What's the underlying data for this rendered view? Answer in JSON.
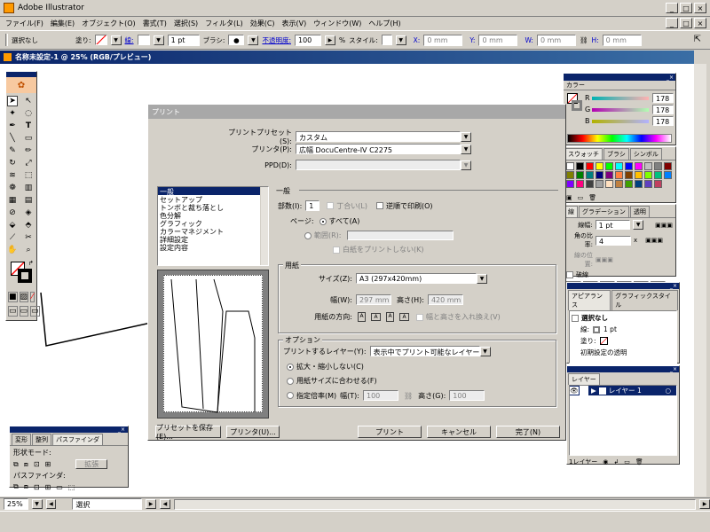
{
  "app": {
    "title": "Adobe Illustrator"
  },
  "menu": [
    "ファイル(F)",
    "編集(E)",
    "オブジェクト(O)",
    "書式(T)",
    "選択(S)",
    "フィルタ(L)",
    "効果(C)",
    "表示(V)",
    "ウィンドウ(W)",
    "ヘルプ(H)"
  ],
  "control": {
    "selection": "選択なし",
    "fill": "塗り:",
    "stroke": "線:",
    "stroke_weight": "1 pt",
    "brush": "ブラシ:",
    "opacity_label": "不透明度:",
    "opacity": "100",
    "percent": "%",
    "style": "スタイル:",
    "x": "X:",
    "y": "Y:",
    "w": "W:",
    "h": "H:",
    "unit": "0 mm"
  },
  "document": {
    "title": "名称未設定-1 @ 25% (RGB/プレビュー)"
  },
  "status": {
    "zoom": "25%",
    "mode": "選択"
  },
  "dialog": {
    "title": "プリント",
    "preset_label": "プリントプリセット(S):",
    "preset": "カスタム",
    "printer_label": "プリンタ(P):",
    "printer": "広幅 DocuCentre-IV C2275",
    "ppd_label": "PPD(D):",
    "categories": [
      "一般",
      "セットアップ",
      "トンボと裁ち落とし",
      "色分解",
      "グラフィック",
      "カラーマネジメント",
      "詳細設定",
      "設定内容"
    ],
    "section_general": "一般",
    "copies_label": "部数(I):",
    "copies": "1",
    "collate": "丁合い(L)",
    "reverse": "逆順で印刷(O)",
    "pages_label": "ページ:",
    "all": "すべて(A)",
    "range": "範囲(R):",
    "skip_blank": "白紙をプリントしない(K)",
    "section_paper": "用紙",
    "size_label": "サイズ(Z):",
    "size": "A3 (297x420mm)",
    "width_label": "幅(W):",
    "width": "297 mm",
    "height_label": "高さ(H):",
    "height": "420 mm",
    "orientation_label": "用紙の方向:",
    "transverse": "幅と高さを入れ換え(V)",
    "section_options": "オプション",
    "layers_label": "プリントするレイヤー(Y):",
    "layers": "表示中でプリント可能なレイヤー",
    "no_scale": "拡大・縮小しない(C)",
    "fit": "用紙サイズに合わせる(F)",
    "custom_scale": "指定倍率(M)",
    "scale_w_label": "幅(T):",
    "scale_w": "100",
    "scale_h_label": "高さ(G):",
    "scale_h": "100",
    "save_preset": "プリセットを保存(E)...",
    "printer_btn": "プリンタ(U)...",
    "print": "プリント",
    "cancel": "キャンセル",
    "done": "完了(N)"
  },
  "color_panel": {
    "title": "カラー",
    "rows": [
      {
        "label": "R",
        "value": "178"
      },
      {
        "label": "G",
        "value": "178"
      },
      {
        "label": "B",
        "value": "178"
      }
    ]
  },
  "swatch_panel": {
    "tabs": [
      "スウォッチ",
      "ブラシ",
      "シンボル"
    ]
  },
  "stroke_panel": {
    "tabs": [
      "線",
      "グラデーション",
      "透明"
    ],
    "weight_label": "線幅:",
    "weight": "1 pt",
    "miter_label": "角の比率:",
    "miter": "4",
    "x": "x",
    "align_label": "線の位置:",
    "dashed": "破線",
    "dash_labels": [
      "線分",
      "間隔",
      "線分",
      "間隔",
      "線分",
      "間隔"
    ]
  },
  "appearance_panel": {
    "tabs": [
      "アピアランス",
      "グラフィックスタイル"
    ],
    "selection": "選択なし",
    "stroke_label": "線:",
    "stroke_value": "1 pt",
    "fill_label": "塗り:",
    "opacity": "初期設定の透明"
  },
  "layers_panel": {
    "tab": "レイヤー",
    "layer": "レイヤー 1",
    "count": "1レイヤー"
  },
  "pathfinder": {
    "tabs": [
      "変形",
      "整列",
      "パスファインダ"
    ],
    "shape_modes": "形状モード:",
    "expand": "拡張",
    "pathfinders": "パスファインダ:"
  },
  "colors": {
    "accent": "#0a246a",
    "swatches": [
      "#ffffff",
      "#000000",
      "#ff0000",
      "#ffff00",
      "#00ff00",
      "#00ffff",
      "#0000ff",
      "#ff00ff",
      "#c0c0c0",
      "#808080",
      "#800000",
      "#808000",
      "#008000",
      "#008080",
      "#000080",
      "#800080",
      "#ff8040",
      "#804000",
      "#ffc000",
      "#80ff00",
      "#00c080",
      "#0080ff",
      "#8000ff",
      "#ff0080",
      "#404040",
      "#a0a0a0",
      "#ffe0c0",
      "#c08040",
      "#40a000",
      "#004080",
      "#6040c0",
      "#c04060"
    ]
  }
}
